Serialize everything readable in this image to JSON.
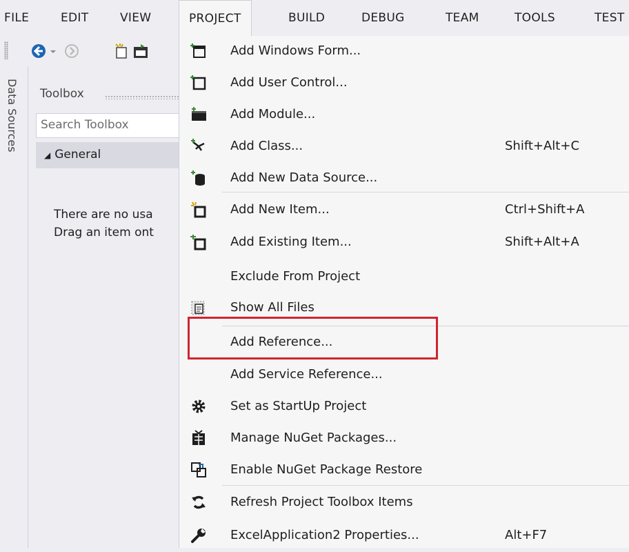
{
  "menubar": {
    "items": [
      "FILE",
      "EDIT",
      "VIEW",
      "PROJECT",
      "BUILD",
      "DEBUG",
      "TEAM",
      "TOOLS",
      "TEST"
    ],
    "active": "PROJECT"
  },
  "side_tab": {
    "label": "Data Sources"
  },
  "toolbox": {
    "title": "Toolbox",
    "search_placeholder": "Search Toolbox",
    "group_label": "General",
    "empty_line1": "There are no usa",
    "empty_line2": "Drag an item ont"
  },
  "project_menu": {
    "items": [
      {
        "label": "Add Windows Form...",
        "shortcut": "",
        "icon": "windows-form-icon"
      },
      {
        "label": "Add User Control...",
        "shortcut": "",
        "icon": "user-control-icon"
      },
      {
        "label": "Add Module...",
        "shortcut": "",
        "icon": "module-icon"
      },
      {
        "label": "Add Class...",
        "shortcut": "Shift+Alt+C",
        "icon": "class-icon"
      },
      {
        "label": "Add New Data Source...",
        "shortcut": "",
        "icon": "data-source-icon"
      },
      {
        "label": "Add New Item...",
        "shortcut": "Ctrl+Shift+A",
        "icon": "new-item-icon"
      },
      {
        "label": "Add Existing Item...",
        "shortcut": "Shift+Alt+A",
        "icon": "existing-item-icon"
      },
      {
        "label": "Exclude From Project",
        "shortcut": "",
        "icon": ""
      },
      {
        "label": "Show All Files",
        "shortcut": "",
        "icon": "show-all-files-icon"
      },
      {
        "label": "Add Reference...",
        "shortcut": "",
        "icon": ""
      },
      {
        "label": "Add Service Reference...",
        "shortcut": "",
        "icon": ""
      },
      {
        "label": "Set as StartUp Project",
        "shortcut": "",
        "icon": "gear-icon"
      },
      {
        "label": "Manage NuGet Packages...",
        "shortcut": "",
        "icon": "nuget-icon"
      },
      {
        "label": "Enable NuGet Package Restore",
        "shortcut": "",
        "icon": "package-restore-icon"
      },
      {
        "label": "Refresh Project Toolbox Items",
        "shortcut": "",
        "icon": "refresh-icon"
      },
      {
        "label": "ExcelApplication2 Properties...",
        "shortcut": "Alt+F7",
        "icon": "wrench-icon"
      }
    ],
    "highlighted_item": "Add Reference..."
  },
  "colors": {
    "menu_bg": "#f6f6f6",
    "highlight_border": "#d1242e",
    "icon_green": "#388a34",
    "icon_dark": "#1e1e1e"
  }
}
